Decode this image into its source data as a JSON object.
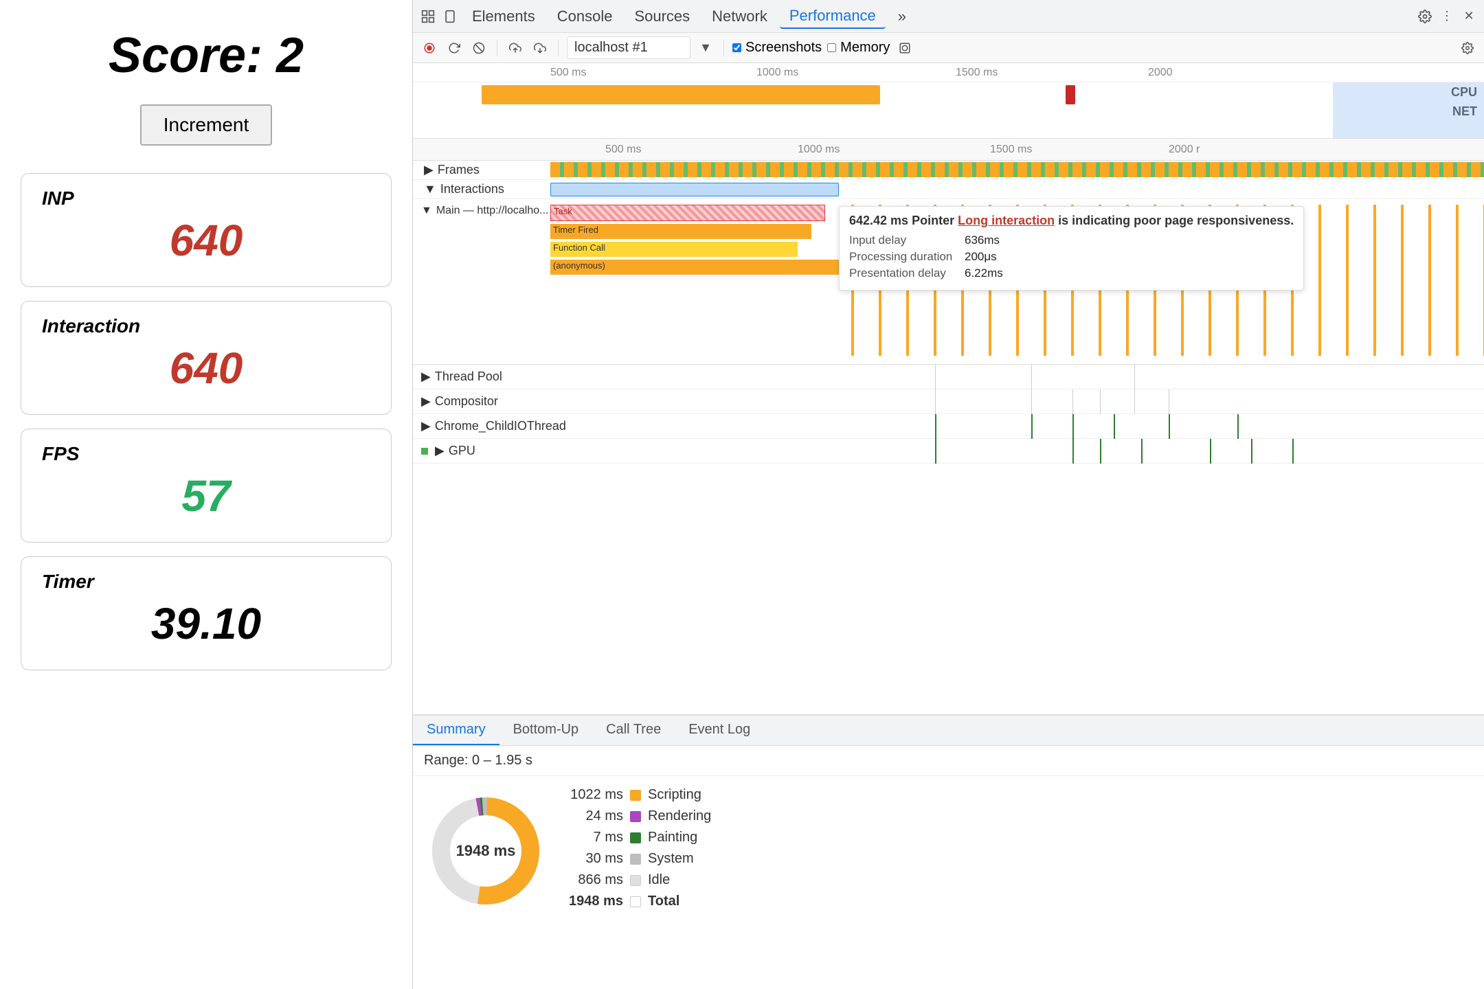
{
  "left": {
    "score_label": "Score: 2",
    "increment_button": "Increment",
    "metrics": [
      {
        "id": "inp",
        "label": "INP",
        "value": "640",
        "color": "red"
      },
      {
        "id": "interaction",
        "label": "Interaction",
        "value": "640",
        "color": "red"
      },
      {
        "id": "fps",
        "label": "FPS",
        "value": "57",
        "color": "green"
      },
      {
        "id": "timer",
        "label": "Timer",
        "value": "39.10",
        "color": "black"
      }
    ]
  },
  "devtools": {
    "tabs": [
      {
        "id": "elements",
        "label": "Elements"
      },
      {
        "id": "console",
        "label": "Console"
      },
      {
        "id": "sources",
        "label": "Sources"
      },
      {
        "id": "network",
        "label": "Network"
      },
      {
        "id": "performance",
        "label": "Performance",
        "active": true
      }
    ],
    "toolbar": {
      "url": "localhost #1",
      "screenshots_label": "Screenshots",
      "memory_label": "Memory"
    },
    "timeline": {
      "ruler_marks": [
        "500 ms",
        "1000 ms",
        "1500 ms",
        "2000"
      ],
      "ruler2_marks": [
        "500 ms",
        "1000 ms",
        "1500 ms",
        "2000 r"
      ],
      "cpu_label": "CPU",
      "net_label": "NET"
    },
    "tracks": {
      "frames_label": "Frames",
      "interactions_label": "Interactions",
      "main_label": "Main — http://localho...",
      "thread_pool_label": "Thread Pool",
      "compositor_label": "Compositor",
      "chrome_child_label": "Chrome_ChildIOThread",
      "gpu_label": "GPU"
    },
    "tooltip": {
      "time": "642.42 ms",
      "type": "Pointer",
      "link_text": "Long interaction",
      "suffix": "is indicating poor page responsiveness.",
      "input_delay_label": "Input delay",
      "input_delay_value": "636ms",
      "processing_label": "Processing duration",
      "processing_value": "200μs",
      "presentation_label": "Presentation delay",
      "presentation_value": "6.22ms"
    },
    "task_bars": [
      {
        "label": "Task",
        "color": "#ef5350",
        "pattern": true
      },
      {
        "label": "Timer Fired",
        "color": "#f9a825"
      },
      {
        "label": "Function Call",
        "color": "#f9a825"
      },
      {
        "label": "(anonymous)",
        "color": "#f9a825"
      }
    ],
    "bottom_tabs": [
      {
        "id": "summary",
        "label": "Summary",
        "active": true
      },
      {
        "id": "bottom-up",
        "label": "Bottom-Up"
      },
      {
        "id": "call-tree",
        "label": "Call Tree"
      },
      {
        "id": "event-log",
        "label": "Event Log"
      }
    ],
    "summary": {
      "range": "Range: 0 – 1.95 s",
      "total_ms": "1948 ms",
      "legend": [
        {
          "ms": "1022 ms",
          "label": "Scripting",
          "color": "#f9a825"
        },
        {
          "ms": "24 ms",
          "label": "Rendering",
          "color": "#ab47bc"
        },
        {
          "ms": "7 ms",
          "label": "Painting",
          "color": "#2e7d32"
        },
        {
          "ms": "30 ms",
          "label": "System",
          "color": "#bdbdbd"
        },
        {
          "ms": "866 ms",
          "label": "Idle",
          "color": "#e0e0e0"
        },
        {
          "ms": "1948 ms",
          "label": "Total",
          "color": "#fff"
        }
      ]
    }
  }
}
